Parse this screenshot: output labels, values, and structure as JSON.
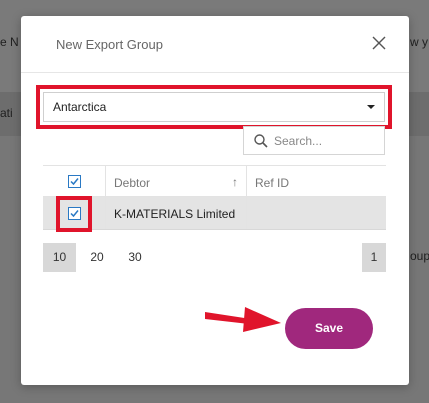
{
  "background": {
    "left_text_top": "e N",
    "right_text_top": "w y",
    "left_text_mid": "ati",
    "right_text_bottom": "oup"
  },
  "modal": {
    "title": "New Export Group"
  },
  "select": {
    "value": "Antarctica"
  },
  "search": {
    "placeholder": "Search..."
  },
  "table": {
    "headers": {
      "debtor": "Debtor",
      "sort_arrow": "↑",
      "ref_id": "Ref ID"
    },
    "rows": [
      {
        "checked": true,
        "debtor": "K-MATERIALS Limited",
        "ref_id": ""
      }
    ]
  },
  "pagination": {
    "sizes": [
      "10",
      "20",
      "30"
    ],
    "active_size": "10",
    "current_page": "1"
  },
  "save_label": "Save",
  "colors": {
    "highlight": "#e0142b",
    "save_button": "#a0287d",
    "checkbox": "#2a79c4"
  }
}
